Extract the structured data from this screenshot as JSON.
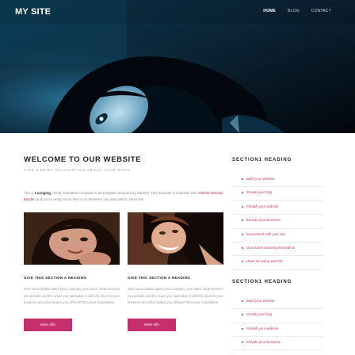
{
  "header": {
    "logo": "MY SITE",
    "nav": [
      {
        "label": "HOME",
        "active": true
      },
      {
        "label": "BLOG",
        "active": false
      },
      {
        "label": "CONTACT",
        "active": false
      }
    ]
  },
  "main": {
    "title": "WELCOME TO OUR WEBSITE",
    "subtitle": "GIVE A BRIEF DESCRIPTION ABOUT YOUR WORK",
    "intro": {
      "prefix": "This is ",
      "bold": "Lounging",
      "middle": ", a fully standards-compliant CSS template designed by SiteFlat. This template is available with ",
      "link": "SiteFlat Website Builder",
      "suffix": ", and you're pretty much free to do whatever you want with it. Have fun!"
    },
    "columns": [
      {
        "title": "GIVE THIS SECTION A HEADING",
        "text": "Give some details about your company, your team, what services you provide and the areas you specialise in with the idea for your business and what makes you different from your competitors.",
        "button": "More info"
      },
      {
        "title": "GIVE THIS SECTION A HEADING",
        "text": "Give some details about your company, your team, what services you provide and the areas you specialise in with the idea for your business and what makes you different from your competitors.",
        "button": "More info"
      }
    ]
  },
  "sidebar": [
    {
      "heading": "SECTION1 HEADING",
      "items": [
        "Build your website",
        "Create your blog",
        "Publish your website",
        "Elevate your business",
        "Experiment with your site",
        "Give some amazing description",
        "Have fun using SiteFlat"
      ]
    },
    {
      "heading": "SECTION1 HEADING",
      "items": [
        "Build your website",
        "Create your blog",
        "Publish your website",
        "Elevate your business"
      ]
    }
  ],
  "colors": {
    "accent": "#c62f6b",
    "hero_dark": "#05121c",
    "hero_blue": "#1f5f80"
  }
}
